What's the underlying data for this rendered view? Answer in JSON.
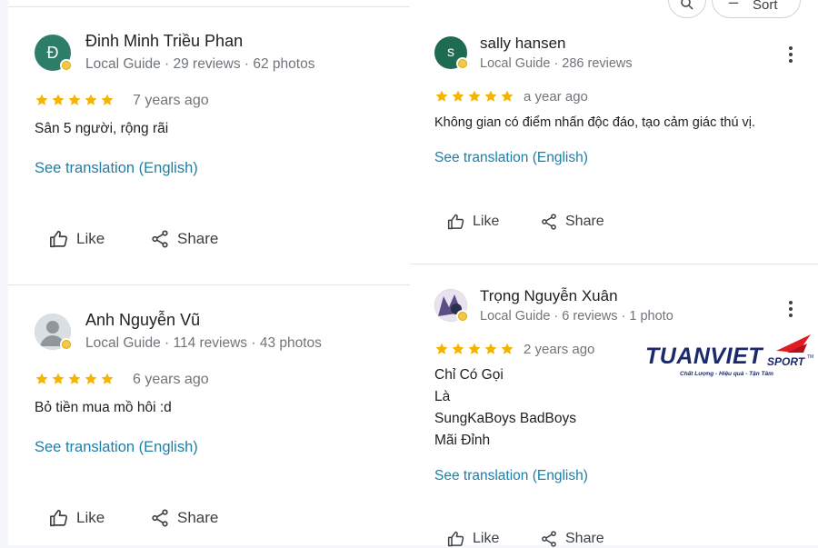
{
  "top_controls": {
    "sort_label": "Sort"
  },
  "actions": {
    "like": "Like",
    "share": "Share"
  },
  "reviews": [
    {
      "name": "Đinh Minh Triều Phan",
      "initial": "Đ",
      "meta": "Local Guide · 29 reviews · 62 photos",
      "rating": 5,
      "ago": "7 years ago",
      "text": "Sân 5 người, rộng rãi",
      "translate": "See translation (English)",
      "avatar_color": "#2e7d6b"
    },
    {
      "name": "Anh Nguyễn Vũ",
      "initial": "",
      "meta": "Local Guide · 114 reviews · 43 photos",
      "rating": 5,
      "ago": "6 years ago",
      "text": "Bỏ tiền mua mồ hôi :d",
      "translate": "See translation (English)",
      "avatar_color": "#9aa4a8"
    },
    {
      "name": "sally hansen",
      "initial": "s",
      "meta": "Local Guide · 286 reviews",
      "rating": 5,
      "ago": "a year ago",
      "text": "Không gian có điểm nhấn độc đáo, tạo cảm giác thú vị.",
      "translate": "See translation (English)",
      "avatar_color": "#1e6b52"
    },
    {
      "name": "Trọng Nguyễn Xuân",
      "initial": "",
      "meta": "Local Guide · 6 reviews · 1 photo",
      "rating": 5,
      "ago": "2 years ago",
      "lines": [
        "Chỉ Có Gọi",
        "Là",
        "SungKaBoys BadBoys",
        "Mãi Đỉnh"
      ],
      "translate": "See translation (English)",
      "avatar_color": "#6a5d8a"
    }
  ],
  "watermark": {
    "brand": "TUANVIET",
    "brand_suffix": "SPORT",
    "tm": "TM",
    "slogan": "Chất Lượng - Hiệu quả - Tận Tâm",
    "colors": {
      "primary": "#1b2a6b",
      "accent": "#e11b22"
    }
  },
  "colors": {
    "star": "#f4b400",
    "link": "#1f7ea6",
    "muted": "#70757a"
  }
}
